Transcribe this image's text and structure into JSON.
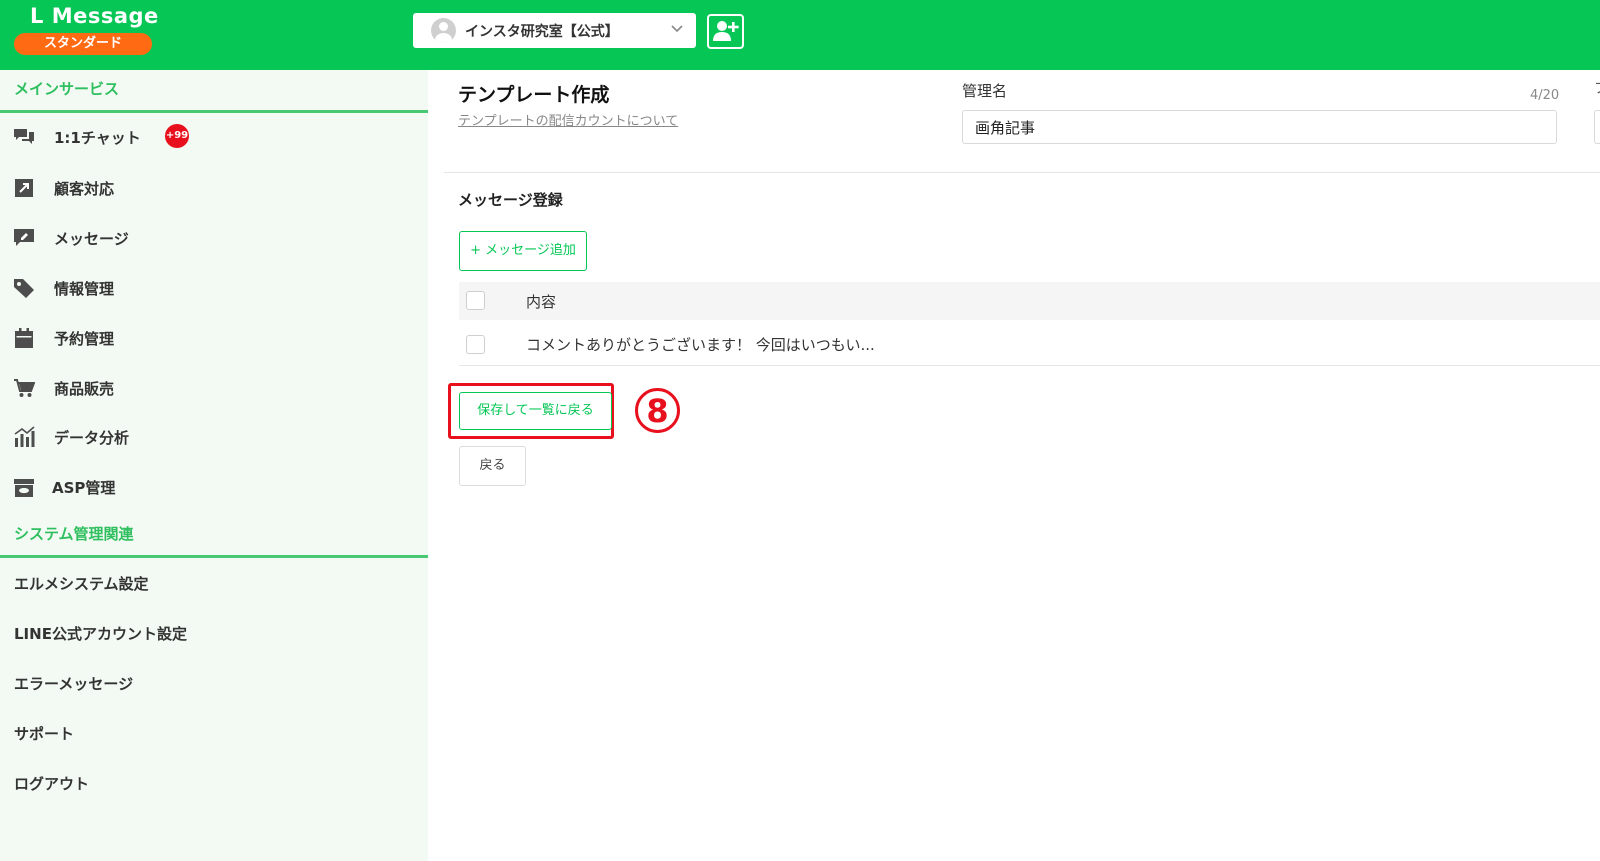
{
  "header": {
    "logo_text": "L Message",
    "plan_badge": "スタンダード",
    "account_name": "インスタ研究室【公式】"
  },
  "sidebar": {
    "main_section_title": "メインサービス",
    "main_items": [
      {
        "label": "1:1チャット",
        "icon": "chat-icon",
        "badge": "+99"
      },
      {
        "label": "顧客対応",
        "icon": "external-link-icon"
      },
      {
        "label": "メッセージ",
        "icon": "message-edit-icon"
      },
      {
        "label": "情報管理",
        "icon": "tag-icon"
      },
      {
        "label": "予約管理",
        "icon": "calendar-icon"
      },
      {
        "label": "商品販売",
        "icon": "cart-icon"
      },
      {
        "label": "データ分析",
        "icon": "chart-icon"
      },
      {
        "label": "ASP管理",
        "icon": "archive-icon"
      }
    ],
    "system_section_title": "システム管理関連",
    "system_items": [
      {
        "label": "エルメシステム設定"
      },
      {
        "label": "LINE公式アカウント設定"
      },
      {
        "label": "エラーメッセージ"
      },
      {
        "label": "サポート"
      },
      {
        "label": "ログアウト"
      }
    ]
  },
  "main": {
    "page_title": "テンプレート作成",
    "page_link": "テンプレートの配信カウントについて",
    "name_label": "管理名",
    "char_count": "4/20",
    "name_value": "画角記事",
    "edge_glyph": "フ",
    "section_heading": "メッセージ登録",
    "add_message_label": "+ メッセージ追加",
    "table_header": "内容",
    "table_rows": [
      {
        "content": "コメントありがとうございます！ 今回はいつもい..."
      }
    ],
    "save_button": "保存して一覧に戻る",
    "step_marker": "8",
    "back_button": "戻る"
  },
  "colors": {
    "brand_green": "#06c755",
    "accent_orange": "#ff6a13",
    "highlight_red": "#e8101c",
    "sidebar_bg": "#f3faf4"
  }
}
